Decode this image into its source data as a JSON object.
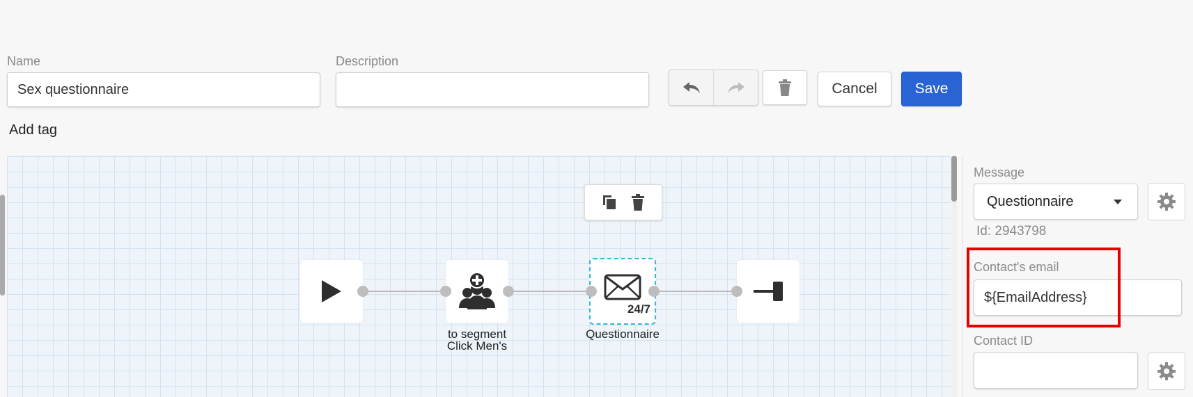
{
  "header": {
    "name_label": "Name",
    "name_value": "Sex questionnaire",
    "description_label": "Description",
    "description_value": "",
    "cancel_label": "Cancel",
    "save_label": "Save",
    "add_tag_label": "Add tag"
  },
  "canvas": {
    "nodes": [
      {
        "type": "start",
        "icon": "play-icon",
        "label": ""
      },
      {
        "type": "segment",
        "icon": "add-to-segment-icon",
        "label_line1": "to segment",
        "label_line2": "Click Men's"
      },
      {
        "type": "message",
        "icon": "envelope-icon",
        "badge": "24/7",
        "label": "Questionnaire"
      },
      {
        "type": "end",
        "icon": "end-icon",
        "label": ""
      }
    ],
    "toolbar_icons": [
      "copy-icon",
      "trash-icon"
    ]
  },
  "panel": {
    "message_label": "Message",
    "message_value": "Questionnaire",
    "id_text": "Id: 2943798",
    "email_label": "Contact's email",
    "email_value": "${EmailAddress}",
    "contact_id_label": "Contact ID",
    "contact_id_value": ""
  },
  "colors": {
    "accent": "#2a63d4",
    "highlight": "#e60000",
    "selection": "#36b6d8"
  }
}
